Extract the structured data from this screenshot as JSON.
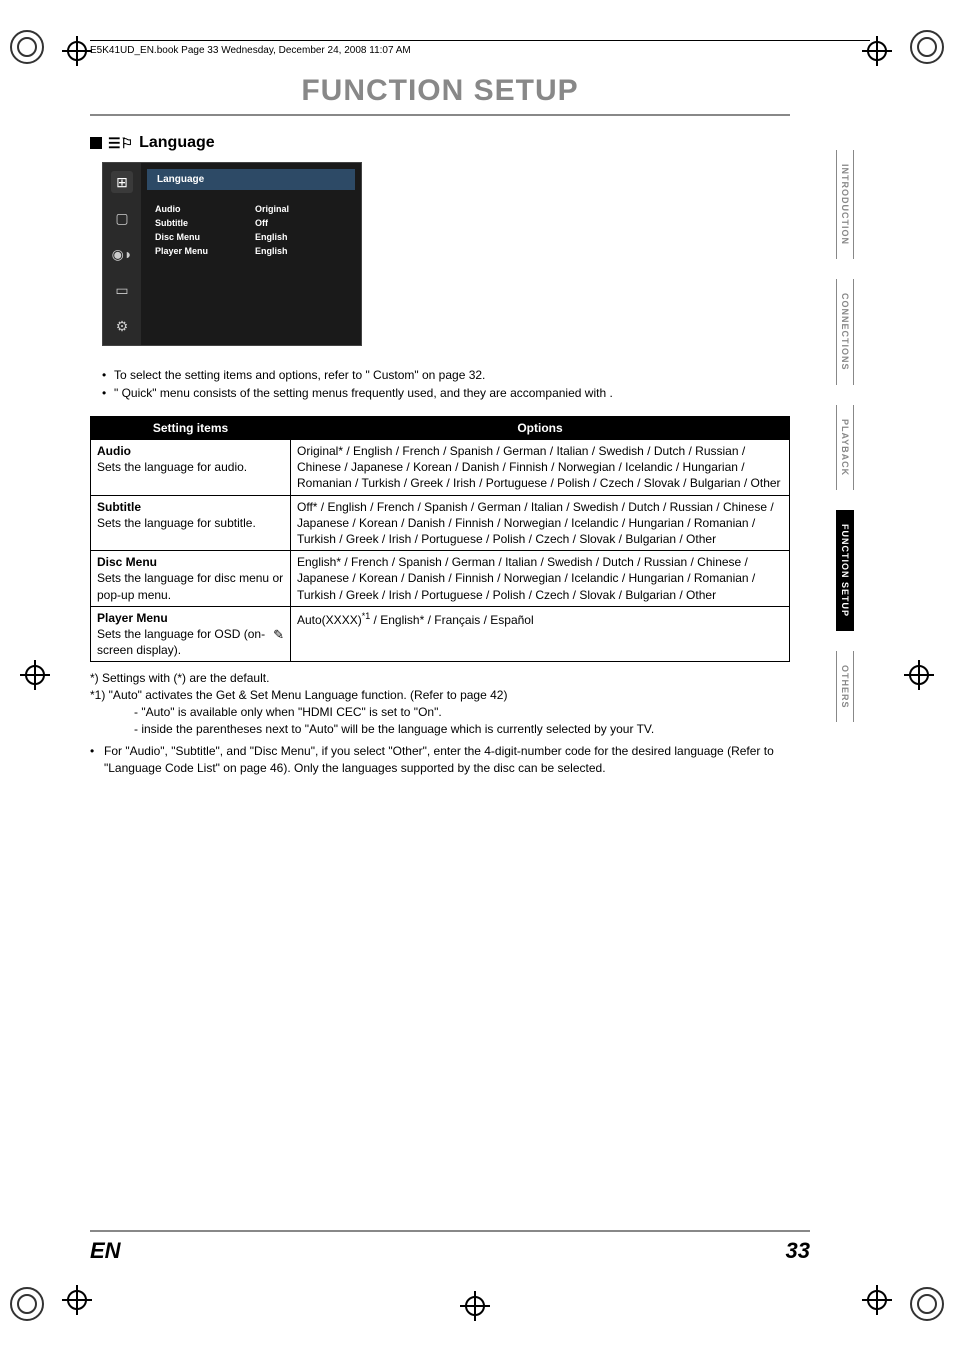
{
  "bookInfo": "E5K41UD_EN.book  Page 33  Wednesday, December 24, 2008  11:07 AM",
  "title": "FUNCTION SETUP",
  "section": {
    "heading": "Language"
  },
  "menu": {
    "title": "Language",
    "rows": {
      "r0": {
        "label": "Audio",
        "value": "Original"
      },
      "r1": {
        "label": "Subtitle",
        "value": "Off"
      },
      "r2": {
        "label": "Disc Menu",
        "value": "English"
      },
      "r3": {
        "label": "Player Menu",
        "value": "English"
      }
    }
  },
  "notes": {
    "n0": "To select the setting items and options, refer to \"   Custom\" on page 32.",
    "n1": "\"   Quick\" menu consists of the setting menus frequently used, and they are accompanied with     ."
  },
  "table": {
    "headers": {
      "left": "Setting items",
      "right": "Options"
    },
    "rows": {
      "r0": {
        "title": "Audio",
        "desc": "Sets the language for audio.",
        "options": "Original* / English / French / Spanish / German / Italian / Swedish / Dutch / Russian / Chinese / Japanese / Korean / Danish / Finnish / Norwegian / Icelandic / Hungarian / Romanian / Turkish / Greek / Irish / Portuguese / Polish / Czech / Slovak / Bulgarian / Other"
      },
      "r1": {
        "title": "Subtitle",
        "desc": "Sets the language for subtitle.",
        "options": "Off* / English / French / Spanish / German / Italian / Swedish / Dutch / Russian / Chinese / Japanese / Korean / Danish / Finnish / Norwegian / Icelandic / Hungarian / Romanian / Turkish / Greek / Irish / Portuguese / Polish / Czech / Slovak / Bulgarian / Other"
      },
      "r2": {
        "title": "Disc Menu",
        "desc": "Sets the language for disc menu or pop-up menu.",
        "options": "English* / French / Spanish / German / Italian / Swedish / Dutch / Russian / Chinese / Japanese / Korean / Danish / Finnish / Norwegian / Icelandic / Hungarian / Romanian / Turkish / Greek / Irish / Portuguese / Polish / Czech / Slovak / Bulgarian / Other"
      },
      "r3": {
        "title": "Player Menu",
        "desc": "Sets the language for OSD (on-screen display).",
        "options_prefix": "Auto(XXXX)",
        "options_suffix": " / English* / Français / Español",
        "sup": "*1"
      }
    }
  },
  "footnotes": {
    "f0": "*) Settings with (*) are the default.",
    "f1": "*1) \"Auto\" activates the Get & Set Menu Language function. (Refer to page 42)",
    "f1a": "- \"Auto\" is available only when \"HDMI CEC\" is set to \"On\".",
    "f1b": "- inside the parentheses next to \"Auto\" will be the language which is currently selected by your TV.",
    "f2": "For \"Audio\", \"Subtitle\", and \"Disc Menu\", if you select \"Other\", enter the 4-digit-number code for the desired language (Refer to \"Language Code List\" on page 46). Only the languages supported by the disc can be selected."
  },
  "sideTabs": {
    "t0": "INTRODUCTION",
    "t1": "CONNECTIONS",
    "t2": "PLAYBACK",
    "t3": "FUNCTION SETUP",
    "t4": "OTHERS"
  },
  "footer": {
    "lang": "EN",
    "page": "33"
  }
}
